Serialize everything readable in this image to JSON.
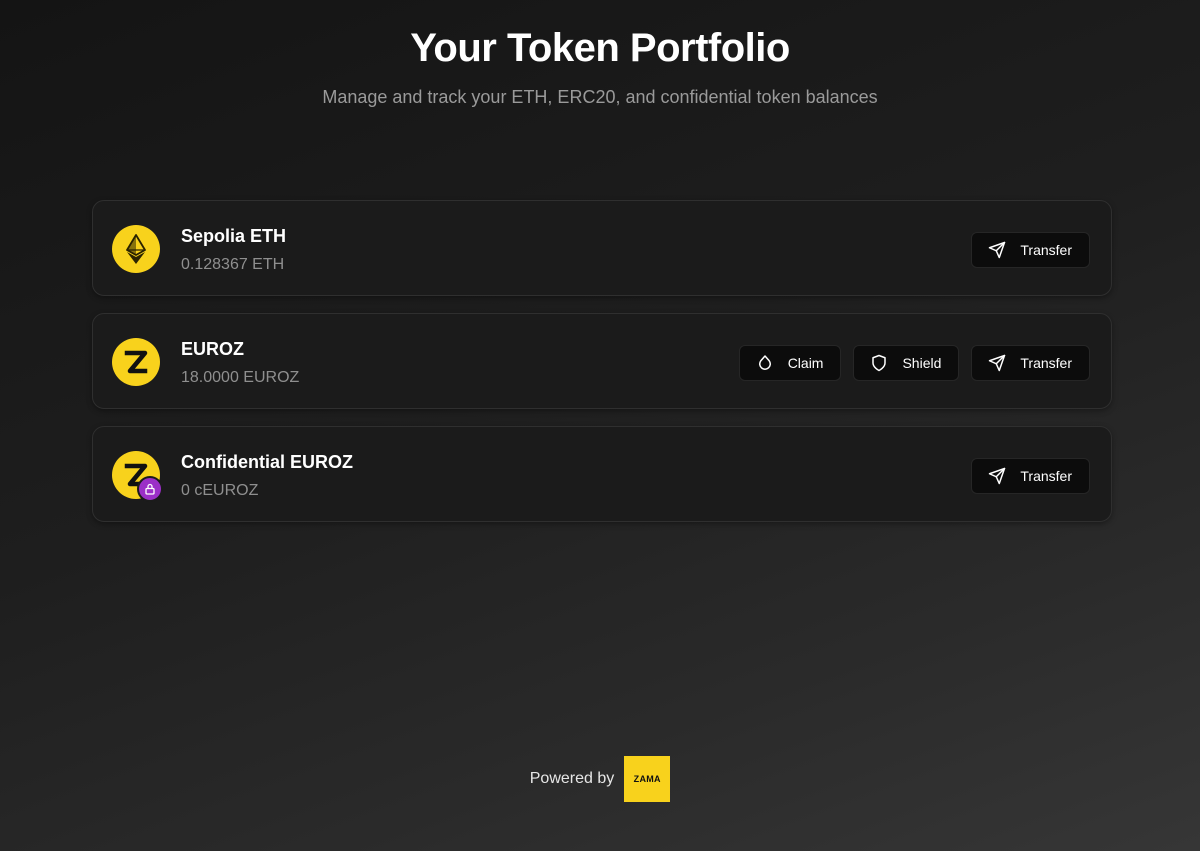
{
  "header": {
    "title": "Your Token Portfolio",
    "subtitle": "Manage and track your ETH, ERC20, and confidential token balances"
  },
  "tokens": [
    {
      "name": "Sepolia ETH",
      "balance": "0.128367 ETH",
      "icon": "ethereum-icon",
      "actions": [
        {
          "label": "Transfer",
          "icon": "send-icon"
        }
      ]
    },
    {
      "name": "EUROZ",
      "balance": "18.0000 EUROZ",
      "icon": "zama-z-icon",
      "actions": [
        {
          "label": "Claim",
          "icon": "droplet-icon"
        },
        {
          "label": "Shield",
          "icon": "shield-icon"
        },
        {
          "label": "Transfer",
          "icon": "send-icon"
        }
      ]
    },
    {
      "name": "Confidential EUROZ",
      "balance": "0 cEUROZ",
      "icon": "zama-z-icon",
      "badge": "lock-icon",
      "actions": [
        {
          "label": "Transfer",
          "icon": "send-icon"
        }
      ]
    }
  ],
  "footer": {
    "powered_by": "Powered by",
    "logo_text": "ZAMA"
  },
  "colors": {
    "accent_yellow": "#f8d21c",
    "lock_badge_purple": "#9b2fc7",
    "card_background": "#1b1b1b",
    "button_background": "#0c0c0c"
  }
}
